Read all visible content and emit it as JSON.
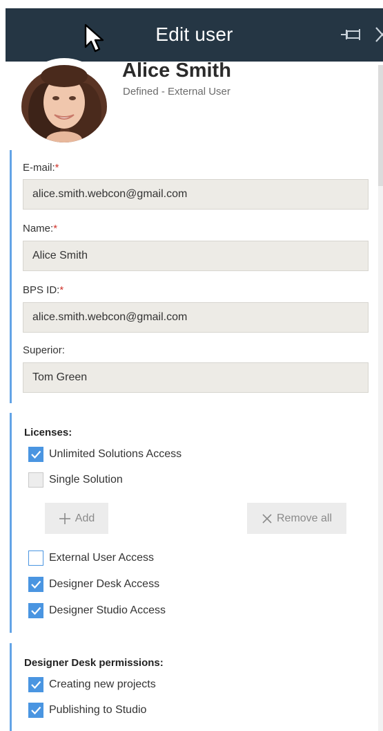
{
  "header": {
    "title": "Edit user"
  },
  "user": {
    "name": "Alice Smith",
    "subtitle": "Defined - External User"
  },
  "form": {
    "email_label": "E-mail:",
    "email_value": "alice.smith.webcon@gmail.com",
    "name_label": "Name:",
    "name_value": "Alice Smith",
    "bpsid_label": "BPS ID:",
    "bpsid_value": "alice.smith.webcon@gmail.com",
    "superior_label": "Superior:",
    "superior_value": "Tom Green",
    "required_mark": "*"
  },
  "licenses": {
    "title": "Licenses:",
    "unlimited": "Unlimited Solutions Access",
    "single": "Single Solution",
    "add_label": "Add",
    "remove_all_label": "Remove all",
    "external": "External User Access",
    "designer_desk": "Designer Desk Access",
    "designer_studio": "Designer Studio Access"
  },
  "permissions": {
    "title": "Designer Desk permissions:",
    "creating": "Creating new projects",
    "publishing": "Publishing to Studio"
  },
  "colors": {
    "header_bg": "#253644",
    "accent": "#4a95e1",
    "field_bg": "#edebe6",
    "required": "#d0342c"
  }
}
